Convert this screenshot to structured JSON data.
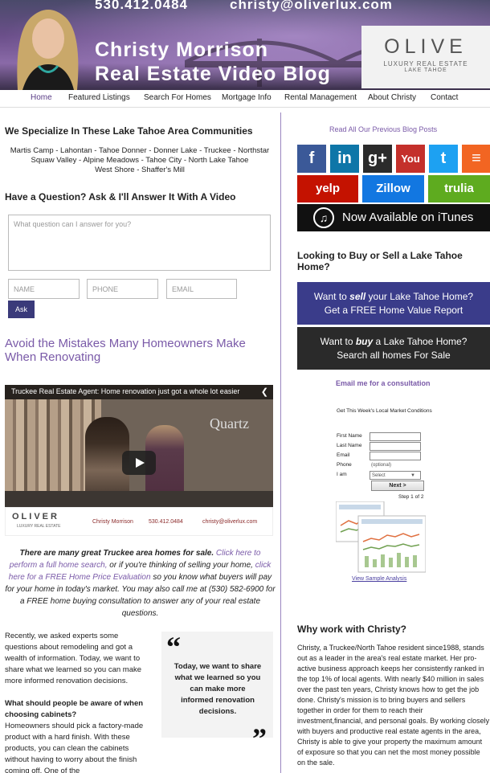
{
  "header": {
    "phone": "530.412.0484",
    "email": "christy@oliverlux.com",
    "title_line1": "Christy Morrison",
    "title_line2": "Real Estate Video Blog",
    "logo_main": "OLIVE",
    "logo_sub1": "LUXURY REAL ESTATE",
    "logo_sub2": "LAKE TAHOE"
  },
  "nav": {
    "items": [
      "Home",
      "Featured Listings",
      "Search For Homes",
      "Mortgage Info",
      "Rental Management",
      "About Christy",
      "Contact"
    ]
  },
  "communities": {
    "heading": "We Specialize In These Lake Tahoe Area Communities",
    "line1": "Martis Camp - Lahontan - Tahoe Donner - Donner Lake - Truckee - Northstar",
    "line2": "Squaw Valley - Alpine Meadows - Tahoe City - North Lake Tahoe",
    "line3": "West Shore - Shaffer's Mill"
  },
  "question": {
    "heading": "Have a Question? Ask & I'll Answer It With A Video",
    "textarea_placeholder": "What question can I answer for you?",
    "name_placeholder": "NAME",
    "phone_placeholder": "PHONE",
    "email_placeholder": "EMAIL",
    "ask_label": "Ask"
  },
  "article": {
    "title": "Avoid the Mistakes Many Homeowners Make When Renovating",
    "video_title": "Truckee Real Estate Agent: Home renovation just got a whole lot easier",
    "video_watermark": "Quartz",
    "video_footer_logo": "OLIVER",
    "video_footer_logo_sub": "LUXURY REAL ESTATE",
    "video_footer_name": "Christy Morrison",
    "video_footer_phone": "530.412.0484",
    "video_footer_email": "christy@oliverlux.com",
    "promo_bold": "There are many great Truckee area homes for sale.",
    "promo_link1": "Click here to perform a full home search,",
    "promo_mid1": "or if you're thinking of selling your home,",
    "promo_link2": "click here for a FREE Home Price Evaluation",
    "promo_tail": "so you know what buyers will pay for your home in today's market. You may also call me at (530) 582-6900 for a FREE home buying consultation to answer any of your real estate questions.",
    "para1": "Recently, we asked experts some questions about remodeling and got a wealth of information. Today, we want to share what we learned so you can make more informed renovation decisions.",
    "subhead": "What should people be aware of when choosing cabinets?",
    "para2": "Homeowners should pick a factory-made product with a hard finish. With these products, you can clean the cabinets without having to worry about the finish coming off. One of the",
    "pull_quote": "Today, we want to share what we learned so you can make more informed renovation decisions."
  },
  "sidebar": {
    "read_all": "Read All Our Previous Blog Posts",
    "social": [
      {
        "name": "facebook",
        "glyph": "f",
        "color": "#3b5998"
      },
      {
        "name": "linkedin",
        "glyph": "in",
        "color": "#0e76a8"
      },
      {
        "name": "googleplus",
        "glyph": "g+",
        "color": "#2b2b2b"
      },
      {
        "name": "youtube",
        "glyph": "You",
        "color": "#c4302b"
      },
      {
        "name": "twitter",
        "glyph": "t",
        "color": "#1da1f2"
      },
      {
        "name": "rss",
        "glyph": "≡",
        "color": "#f26522"
      }
    ],
    "brands": [
      {
        "name": "yelp",
        "label": "yelp",
        "color": "#c41200"
      },
      {
        "name": "zillow",
        "label": "Zillow",
        "color": "#1277e1"
      },
      {
        "name": "trulia",
        "label": "trulia",
        "color": "#5eab1f"
      }
    ],
    "itunes_label": "Now Available on iTunes",
    "buy_sell_heading": "Looking to Buy or Sell a Lake Tahoe Home?",
    "sell_banner_line1_pre": "Want to",
    "sell_banner_line1_em": "sell",
    "sell_banner_line1_post": "your Lake Tahoe Home?",
    "sell_banner_line2": "Get a FREE Home Value Report",
    "buy_banner_line1_pre": "Want to",
    "buy_banner_line1_em": "buy",
    "buy_banner_line1_post": "a Lake Tahoe Home?",
    "buy_banner_line2": "Search all homes For Sale",
    "email_consult": "Email me for a consultation",
    "form_title": "Get This Week's Local Market Conditions",
    "form_first": "First Name",
    "form_last": "Last Name",
    "form_email": "Email",
    "form_phone": "Phone",
    "form_phone_hint": "(optional)",
    "form_iam": "I am",
    "form_select": "Select",
    "form_next": "Next >",
    "form_step": "Step 1 of 2",
    "view_sample": "View Sample Analysis",
    "why_heading": "Why work with Christy?",
    "why_text": "Christy, a Truckee/North Tahoe resident since1988, stands out as a leader in the area's real estate market. Her pro-active business approach keeps her consistently ranked in the top 1% of local agents. With nearly $40 million in sales over the past ten years, Christy knows how to get the job done. Christy's mission is to bring buyers and sellers together in order for them to reach their investment,financial, and personal goals. By working closely with buyers and productive real estate agents in the area, Christy is able to give your property the maximum amount of exposure so that you can net the most money possible on the sale."
  },
  "colors": {
    "accent": "#7a5aa8",
    "sell_banner": "#3a3c8a",
    "buy_banner": "#2a2a2a",
    "ask_button": "#3a3a7a"
  }
}
